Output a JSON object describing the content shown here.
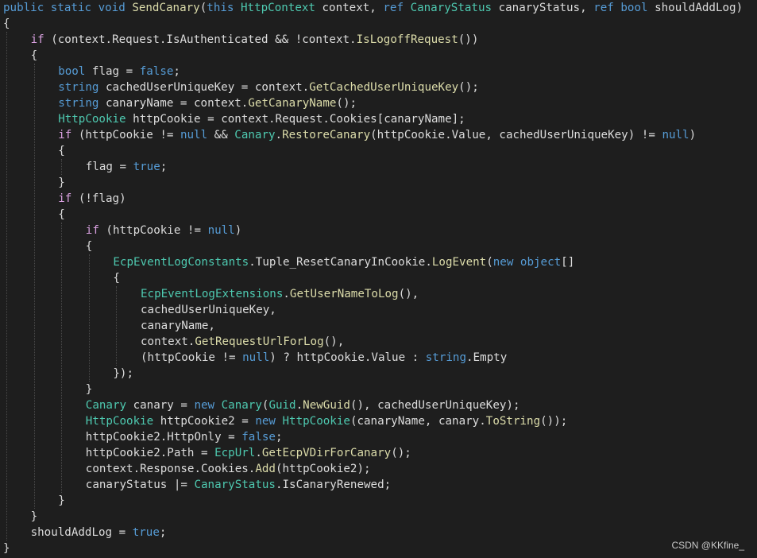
{
  "editor": {
    "language": "csharp",
    "lines": [
      {
        "indent": 0,
        "tokens": [
          {
            "t": "kw",
            "s": "public"
          },
          {
            "t": "plain",
            "s": " "
          },
          {
            "t": "kw",
            "s": "static"
          },
          {
            "t": "plain",
            "s": " "
          },
          {
            "t": "kw",
            "s": "void"
          },
          {
            "t": "plain",
            "s": " "
          },
          {
            "t": "method",
            "s": "SendCanary"
          },
          {
            "t": "plain",
            "s": "("
          },
          {
            "t": "kw",
            "s": "this"
          },
          {
            "t": "plain",
            "s": " "
          },
          {
            "t": "type",
            "s": "HttpContext"
          },
          {
            "t": "plain",
            "s": " context, "
          },
          {
            "t": "kw",
            "s": "ref"
          },
          {
            "t": "plain",
            "s": " "
          },
          {
            "t": "type",
            "s": "CanaryStatus"
          },
          {
            "t": "plain",
            "s": " canaryStatus, "
          },
          {
            "t": "kw",
            "s": "ref"
          },
          {
            "t": "plain",
            "s": " "
          },
          {
            "t": "kw",
            "s": "bool"
          },
          {
            "t": "plain",
            "s": " shouldAddLog)"
          }
        ]
      },
      {
        "indent": 0,
        "tokens": [
          {
            "t": "plain",
            "s": "{"
          }
        ]
      },
      {
        "indent": 1,
        "tokens": [
          {
            "t": "ctl",
            "s": "if"
          },
          {
            "t": "plain",
            "s": " (context.Request.IsAuthenticated && !context."
          },
          {
            "t": "method",
            "s": "IsLogoffRequest"
          },
          {
            "t": "plain",
            "s": "())"
          }
        ]
      },
      {
        "indent": 1,
        "tokens": [
          {
            "t": "plain",
            "s": "{"
          }
        ]
      },
      {
        "indent": 2,
        "tokens": [
          {
            "t": "kw",
            "s": "bool"
          },
          {
            "t": "plain",
            "s": " flag = "
          },
          {
            "t": "kw",
            "s": "false"
          },
          {
            "t": "plain",
            "s": ";"
          }
        ]
      },
      {
        "indent": 2,
        "tokens": [
          {
            "t": "kw",
            "s": "string"
          },
          {
            "t": "plain",
            "s": " cachedUserUniqueKey = context."
          },
          {
            "t": "method",
            "s": "GetCachedUserUniqueKey"
          },
          {
            "t": "plain",
            "s": "();"
          }
        ]
      },
      {
        "indent": 2,
        "tokens": [
          {
            "t": "kw",
            "s": "string"
          },
          {
            "t": "plain",
            "s": " canaryName = context."
          },
          {
            "t": "method",
            "s": "GetCanaryName"
          },
          {
            "t": "plain",
            "s": "();"
          }
        ]
      },
      {
        "indent": 2,
        "tokens": [
          {
            "t": "type",
            "s": "HttpCookie"
          },
          {
            "t": "plain",
            "s": " httpCookie = context.Request.Cookies[canaryName];"
          }
        ]
      },
      {
        "indent": 2,
        "tokens": [
          {
            "t": "ctl",
            "s": "if"
          },
          {
            "t": "plain",
            "s": " (httpCookie != "
          },
          {
            "t": "kw",
            "s": "null"
          },
          {
            "t": "plain",
            "s": " && "
          },
          {
            "t": "type",
            "s": "Canary"
          },
          {
            "t": "plain",
            "s": "."
          },
          {
            "t": "method",
            "s": "RestoreCanary"
          },
          {
            "t": "plain",
            "s": "(httpCookie.Value, cachedUserUniqueKey) != "
          },
          {
            "t": "kw",
            "s": "null"
          },
          {
            "t": "plain",
            "s": ")"
          }
        ]
      },
      {
        "indent": 2,
        "tokens": [
          {
            "t": "plain",
            "s": "{"
          }
        ]
      },
      {
        "indent": 3,
        "tokens": [
          {
            "t": "plain",
            "s": "flag = "
          },
          {
            "t": "kw",
            "s": "true"
          },
          {
            "t": "plain",
            "s": ";"
          }
        ]
      },
      {
        "indent": 2,
        "tokens": [
          {
            "t": "plain",
            "s": "}"
          }
        ]
      },
      {
        "indent": 2,
        "tokens": [
          {
            "t": "ctl",
            "s": "if"
          },
          {
            "t": "plain",
            "s": " (!flag)"
          }
        ]
      },
      {
        "indent": 2,
        "tokens": [
          {
            "t": "plain",
            "s": "{"
          }
        ]
      },
      {
        "indent": 3,
        "tokens": [
          {
            "t": "ctl",
            "s": "if"
          },
          {
            "t": "plain",
            "s": " (httpCookie != "
          },
          {
            "t": "kw",
            "s": "null"
          },
          {
            "t": "plain",
            "s": ")"
          }
        ]
      },
      {
        "indent": 3,
        "tokens": [
          {
            "t": "plain",
            "s": "{"
          }
        ]
      },
      {
        "indent": 4,
        "tokens": [
          {
            "t": "type",
            "s": "EcpEventLogConstants"
          },
          {
            "t": "plain",
            "s": ".Tuple_ResetCanaryInCookie."
          },
          {
            "t": "method",
            "s": "LogEvent"
          },
          {
            "t": "plain",
            "s": "("
          },
          {
            "t": "kw",
            "s": "new"
          },
          {
            "t": "plain",
            "s": " "
          },
          {
            "t": "kw",
            "s": "object"
          },
          {
            "t": "plain",
            "s": "[]"
          }
        ]
      },
      {
        "indent": 4,
        "tokens": [
          {
            "t": "plain",
            "s": "{"
          }
        ]
      },
      {
        "indent": 5,
        "tokens": [
          {
            "t": "type",
            "s": "EcpEventLogExtensions"
          },
          {
            "t": "plain",
            "s": "."
          },
          {
            "t": "method",
            "s": "GetUserNameToLog"
          },
          {
            "t": "plain",
            "s": "(),"
          }
        ]
      },
      {
        "indent": 5,
        "tokens": [
          {
            "t": "plain",
            "s": "cachedUserUniqueKey,"
          }
        ]
      },
      {
        "indent": 5,
        "tokens": [
          {
            "t": "plain",
            "s": "canaryName,"
          }
        ]
      },
      {
        "indent": 5,
        "tokens": [
          {
            "t": "plain",
            "s": "context."
          },
          {
            "t": "method",
            "s": "GetRequestUrlForLog"
          },
          {
            "t": "plain",
            "s": "(),"
          }
        ]
      },
      {
        "indent": 5,
        "tokens": [
          {
            "t": "plain",
            "s": "(httpCookie != "
          },
          {
            "t": "kw",
            "s": "null"
          },
          {
            "t": "plain",
            "s": ") ? httpCookie.Value : "
          },
          {
            "t": "kw",
            "s": "string"
          },
          {
            "t": "plain",
            "s": ".Empty"
          }
        ]
      },
      {
        "indent": 4,
        "tokens": [
          {
            "t": "plain",
            "s": "});"
          }
        ]
      },
      {
        "indent": 3,
        "tokens": [
          {
            "t": "plain",
            "s": "}"
          }
        ]
      },
      {
        "indent": 3,
        "tokens": [
          {
            "t": "type",
            "s": "Canary"
          },
          {
            "t": "plain",
            "s": " canary = "
          },
          {
            "t": "kw",
            "s": "new"
          },
          {
            "t": "plain",
            "s": " "
          },
          {
            "t": "type",
            "s": "Canary"
          },
          {
            "t": "plain",
            "s": "("
          },
          {
            "t": "type",
            "s": "Guid"
          },
          {
            "t": "plain",
            "s": "."
          },
          {
            "t": "method",
            "s": "NewGuid"
          },
          {
            "t": "plain",
            "s": "(), cachedUserUniqueKey);"
          }
        ]
      },
      {
        "indent": 3,
        "tokens": [
          {
            "t": "type",
            "s": "HttpCookie"
          },
          {
            "t": "plain",
            "s": " httpCookie2 = "
          },
          {
            "t": "kw",
            "s": "new"
          },
          {
            "t": "plain",
            "s": " "
          },
          {
            "t": "type",
            "s": "HttpCookie"
          },
          {
            "t": "plain",
            "s": "(canaryName, canary."
          },
          {
            "t": "method",
            "s": "ToString"
          },
          {
            "t": "plain",
            "s": "());"
          }
        ]
      },
      {
        "indent": 3,
        "tokens": [
          {
            "t": "plain",
            "s": "httpCookie2.HttpOnly = "
          },
          {
            "t": "kw",
            "s": "false"
          },
          {
            "t": "plain",
            "s": ";"
          }
        ]
      },
      {
        "indent": 3,
        "tokens": [
          {
            "t": "plain",
            "s": "httpCookie2.Path = "
          },
          {
            "t": "type",
            "s": "EcpUrl"
          },
          {
            "t": "plain",
            "s": "."
          },
          {
            "t": "method",
            "s": "GetEcpVDirForCanary"
          },
          {
            "t": "plain",
            "s": "();"
          }
        ]
      },
      {
        "indent": 3,
        "tokens": [
          {
            "t": "plain",
            "s": "context.Response.Cookies."
          },
          {
            "t": "method",
            "s": "Add"
          },
          {
            "t": "plain",
            "s": "(httpCookie2);"
          }
        ]
      },
      {
        "indent": 3,
        "tokens": [
          {
            "t": "plain",
            "s": "canaryStatus |= "
          },
          {
            "t": "type",
            "s": "CanaryStatus"
          },
          {
            "t": "plain",
            "s": ".IsCanaryRenewed;"
          }
        ]
      },
      {
        "indent": 2,
        "tokens": [
          {
            "t": "plain",
            "s": "}"
          }
        ]
      },
      {
        "indent": 1,
        "tokens": [
          {
            "t": "plain",
            "s": "}"
          }
        ]
      },
      {
        "indent": 1,
        "tokens": [
          {
            "t": "plain",
            "s": "shouldAddLog = "
          },
          {
            "t": "kw",
            "s": "true"
          },
          {
            "t": "plain",
            "s": ";"
          }
        ]
      },
      {
        "indent": 0,
        "tokens": [
          {
            "t": "plain",
            "s": "}"
          }
        ]
      }
    ]
  },
  "watermark": "CSDN @KKfine_"
}
